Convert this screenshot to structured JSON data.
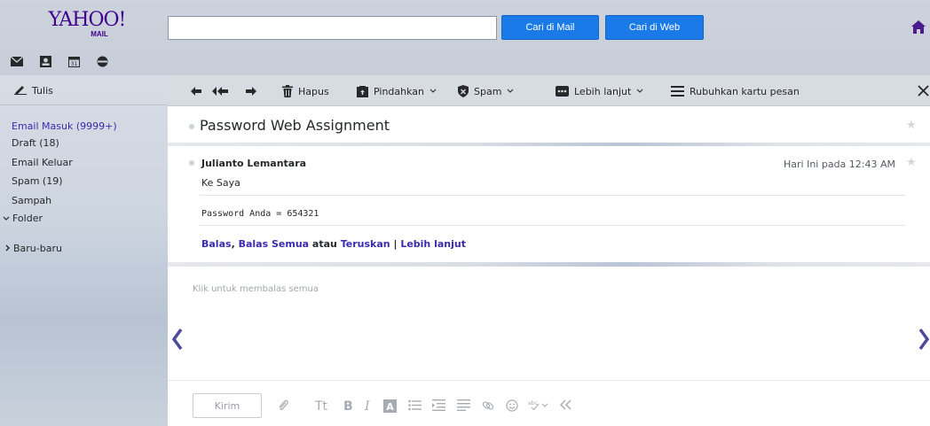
{
  "brand": {
    "logo_text": "YAHOO!",
    "logo_sub": "MAIL"
  },
  "search": {
    "value": "",
    "placeholder": "",
    "mail_button": "Cari di Mail",
    "web_button": "Cari di Web"
  },
  "app_icons": [
    "mail-icon",
    "contacts-icon",
    "calendar-icon",
    "notepad-icon"
  ],
  "sidebar": {
    "compose_label": "Tulis",
    "items": [
      {
        "label": "Email Masuk (9999+)",
        "active": true
      },
      {
        "label": "Draft (18)"
      },
      {
        "label": "Email Keluar"
      },
      {
        "label": "Spam (19)"
      },
      {
        "label": "Sampah"
      }
    ],
    "folders_label": "Folder",
    "recent_label": "Baru-baru"
  },
  "toolbar": {
    "delete_label": "Hapus",
    "move_label": "Pindahkan",
    "spam_label": "Spam",
    "more_label": "Lebih lanjut",
    "collapse_label": "Rubuhkan kartu pesan"
  },
  "message": {
    "subject": "Password Web Assignment",
    "sender": "Julianto Lemantara",
    "recipient": "Ke  Saya",
    "timestamp": "Hari Ini pada 12:43 AM",
    "body": "Password Anda = 654321",
    "actions": {
      "reply": "Balas",
      "comma": ",",
      "reply_all": "Balas Semua",
      "or": "atau",
      "forward": "Teruskan",
      "pipe": "|",
      "more": "Lebih lanjut"
    }
  },
  "reply": {
    "placeholder": "Klik untuk membalas semua",
    "send_label": "Kirim"
  },
  "colors": {
    "accent": "#1a7be8",
    "link": "#3b2bb0",
    "brand": "#400090"
  }
}
